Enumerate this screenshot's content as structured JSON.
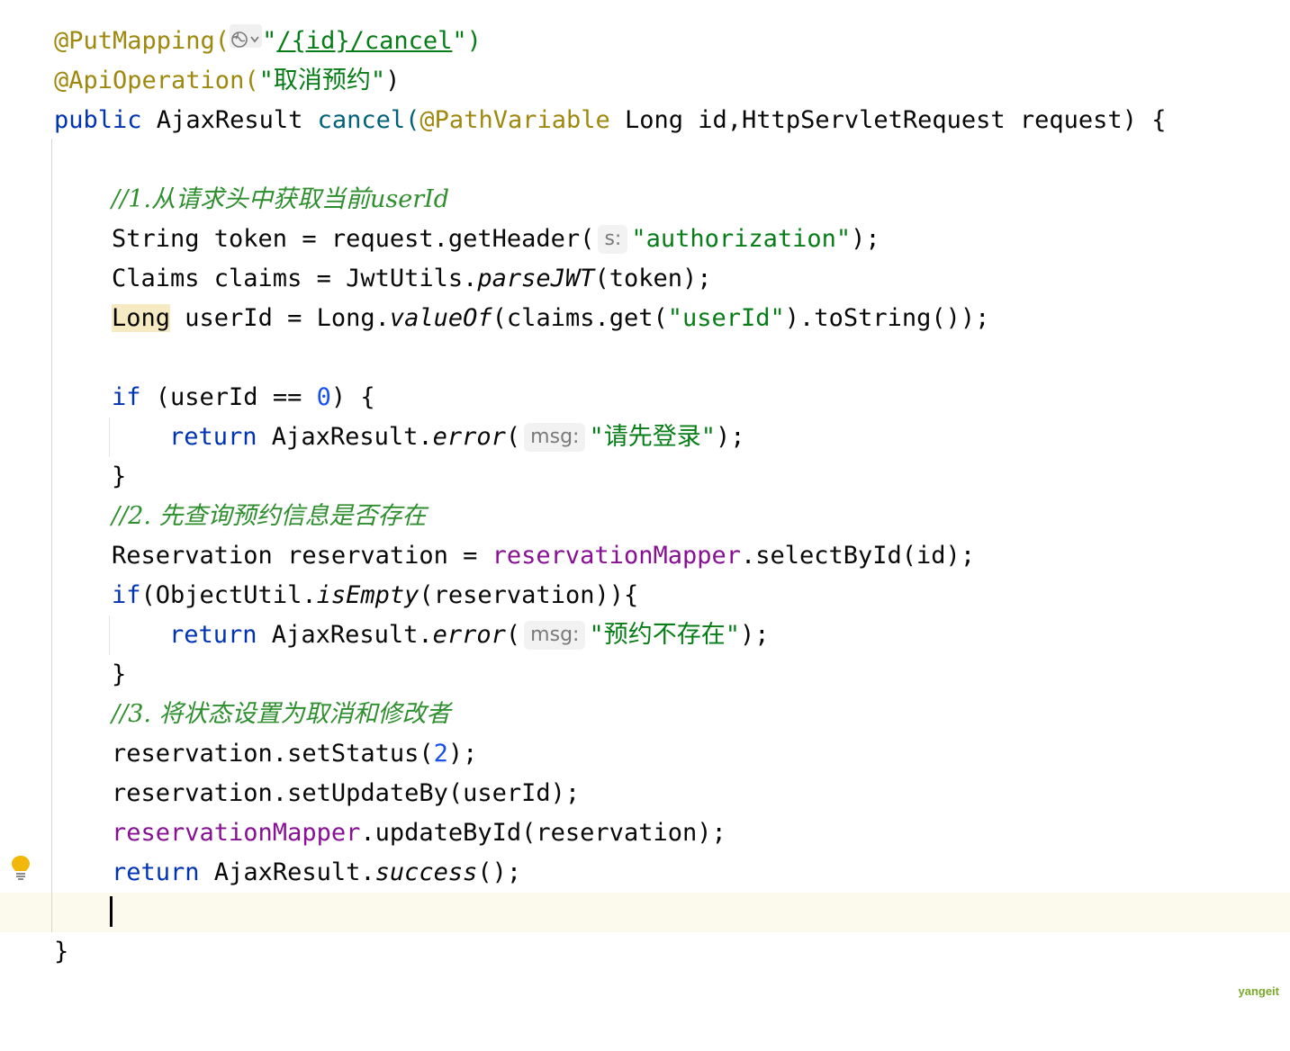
{
  "editor": {
    "lines": {
      "l1": {
        "annotation": "@PutMapping(",
        "quote_open": "\"",
        "path": "/{id}/cancel",
        "quote_close": "\")"
      },
      "l2": {
        "annotation": "@ApiOperation(",
        "string": "\"取消预约\"",
        "close": ")"
      },
      "l3": {
        "kw": "public",
        "type": " AjaxResult ",
        "method": "cancel(",
        "annotation": "@PathVariable",
        "rest": " Long id,HttpServletRequest request) {"
      },
      "l4": {
        "comment_prefix": "//1.",
        "comment_text": "从请求头中获取当前",
        "comment_suffix": "userId"
      },
      "l5": {
        "code": "String token = request.getHeader(",
        "hint": "s:",
        "string": "\"authorization\"",
        "end": ");"
      },
      "l6": {
        "code1": "Claims claims = JwtUtils.",
        "italic": "parseJWT",
        "code2": "(token);"
      },
      "l7": {
        "highlight": "Long",
        "code1": " userId = Long.",
        "italic": "valueOf",
        "code2": "(claims.get(",
        "string": "\"userId\"",
        "code3": ").toString());"
      },
      "l8": {
        "kw": "if",
        "code1": " (userId == ",
        "number": "0",
        "code2": ") {"
      },
      "l9": {
        "kw": "return",
        "code1": " AjaxResult.",
        "italic": "error",
        "paren": "(",
        "hint": "msg:",
        "string": "\"请先登录\"",
        "end": ");"
      },
      "l10": {
        "code": "}"
      },
      "l11": {
        "comment_prefix": "//2. ",
        "comment_text": "先查询预约信息是否存在"
      },
      "l12": {
        "code1": "Reservation reservation = ",
        "field": "reservationMapper",
        "code2": ".selectById(id);"
      },
      "l13": {
        "kw": "if",
        "code1": "(ObjectUtil.",
        "italic": "isEmpty",
        "code2": "(reservation)){"
      },
      "l14": {
        "kw": "return",
        "code1": " AjaxResult.",
        "italic": "error",
        "paren": "(",
        "hint": "msg:",
        "string": "\"预约不存在\"",
        "end": ");"
      },
      "l15": {
        "code": "}"
      },
      "l16": {
        "comment_prefix": "//3. ",
        "comment_text": "将状态设置为取消和修改者"
      },
      "l17": {
        "code1": "reservation.setStatus(",
        "number": "2",
        "code2": ");"
      },
      "l18": {
        "code": "reservation.setUpdateBy(userId);"
      },
      "l19": {
        "field": "reservationMapper",
        "code": ".updateById(reservation);"
      },
      "l20": {
        "kw": "return",
        "code1": " AjaxResult.",
        "italic": "success",
        "code2": "();"
      },
      "l22": {
        "code": "}"
      }
    },
    "gutter": {
      "intention_icon": "lightbulb-icon",
      "globe_icon": "globe-icon"
    }
  },
  "watermark": "yangeit",
  "colors": {
    "annotation": "#9e880d",
    "keyword": "#0033b3",
    "string": "#067d17",
    "number": "#1750eb",
    "field": "#871094",
    "comment": "#2f8f2f",
    "current_line": "#fcfaed",
    "highlight": "#f5eac2"
  }
}
